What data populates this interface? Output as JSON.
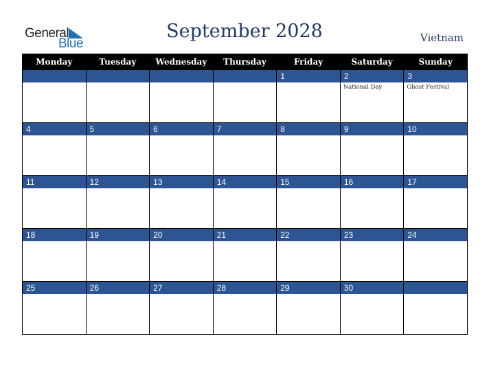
{
  "logo": {
    "word1": "General",
    "word2": "Blue",
    "icon": "triangle-flag-icon"
  },
  "title": "September 2028",
  "country": "Vietnam",
  "colors": {
    "title": "#233a63",
    "day_bar": "#2d5493",
    "header_bg": "#000000",
    "logo_blue": "#1f6fb2"
  },
  "weekdays": [
    "Monday",
    "Tuesday",
    "Wednesday",
    "Thursday",
    "Friday",
    "Saturday",
    "Sunday"
  ],
  "weeks": [
    [
      {
        "day": ""
      },
      {
        "day": ""
      },
      {
        "day": ""
      },
      {
        "day": ""
      },
      {
        "day": "1"
      },
      {
        "day": "2",
        "holiday": "National Day"
      },
      {
        "day": "3",
        "holiday": "Ghost Festival"
      }
    ],
    [
      {
        "day": "4"
      },
      {
        "day": "5"
      },
      {
        "day": "6"
      },
      {
        "day": "7"
      },
      {
        "day": "8"
      },
      {
        "day": "9"
      },
      {
        "day": "10"
      }
    ],
    [
      {
        "day": "11"
      },
      {
        "day": "12"
      },
      {
        "day": "13"
      },
      {
        "day": "14"
      },
      {
        "day": "15"
      },
      {
        "day": "16"
      },
      {
        "day": "17"
      }
    ],
    [
      {
        "day": "18"
      },
      {
        "day": "19"
      },
      {
        "day": "20"
      },
      {
        "day": "21"
      },
      {
        "day": "22"
      },
      {
        "day": "23"
      },
      {
        "day": "24"
      }
    ],
    [
      {
        "day": "25"
      },
      {
        "day": "26"
      },
      {
        "day": "27"
      },
      {
        "day": "28"
      },
      {
        "day": "29"
      },
      {
        "day": "30"
      },
      {
        "day": ""
      }
    ]
  ]
}
